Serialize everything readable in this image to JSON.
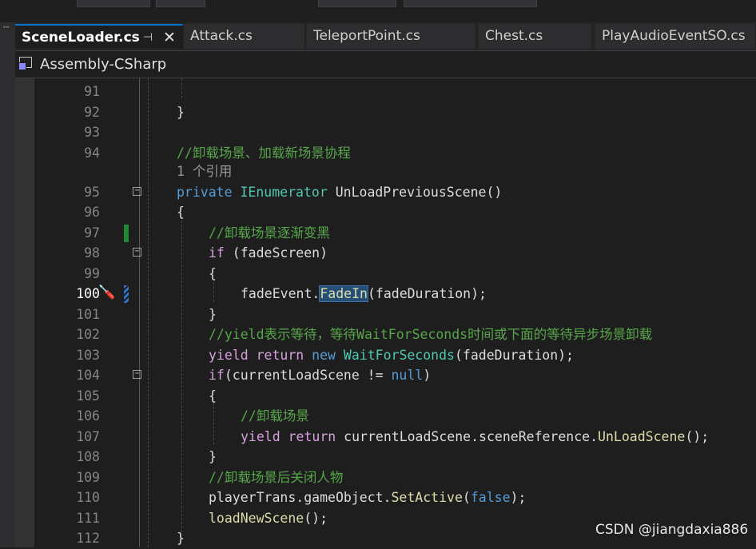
{
  "tabs": [
    {
      "label": "SceneLoader.cs",
      "active": true,
      "pin_icon": "pin-icon",
      "close_icon": "close-icon"
    },
    {
      "label": "Attack.cs"
    },
    {
      "label": "TeleportPoint.cs"
    },
    {
      "label": "Chest.cs"
    },
    {
      "label": "PlayAudioEventSO.cs"
    }
  ],
  "navbar": {
    "project": "Assembly-CSharp",
    "icon": "csharp-project-icon"
  },
  "code": {
    "lines": [
      {
        "n": "91"
      },
      {
        "n": "92",
        "text": "}"
      },
      {
        "n": "93"
      },
      {
        "n": "94",
        "comment": "//卸载场景、加载新场景协程"
      },
      {
        "hint": "1 个引用"
      },
      {
        "n": "95",
        "kw": "private",
        "type": "IEnumerator",
        "rest": "UnLoadPreviousScene()"
      },
      {
        "n": "96",
        "text": "{"
      },
      {
        "n": "97",
        "comment": "//卸载场景逐渐变黑"
      },
      {
        "n": "98",
        "kw": "if",
        "rest": " (fadeScreen)"
      },
      {
        "n": "99",
        "text": "{"
      },
      {
        "n": "100",
        "obj": "fadeEvent.",
        "method": "FadeIn",
        "args": "(fadeDuration)",
        "end": ";"
      },
      {
        "n": "101",
        "text": "}"
      },
      {
        "n": "102",
        "comment": "//yield表示等待，等待WaitForSeconds时间或下面的等待异步场景卸载"
      },
      {
        "n": "103",
        "kw1": "yield",
        "kw2": "return",
        "kw3": "new",
        "type": "WaitForSeconds",
        "rest": "(fadeDuration);"
      },
      {
        "n": "104",
        "kw": "if",
        "rest": "(currentLoadScene != ",
        "lit": "null",
        "end": ")"
      },
      {
        "n": "105",
        "text": "{"
      },
      {
        "n": "106",
        "comment": "//卸载场景"
      },
      {
        "n": "107",
        "kw1": "yield",
        "kw2": "return",
        "obj": "currentLoadScene.sceneReference.",
        "method": "UnLoadScene",
        "end": "();"
      },
      {
        "n": "108",
        "text": "}"
      },
      {
        "n": "109",
        "comment": "//卸载场景后关闭人物"
      },
      {
        "n": "110",
        "obj": "playerTrans.gameObject.",
        "method": "SetActive",
        "args_open": "(",
        "lit": "false",
        "end": ");"
      },
      {
        "n": "111",
        "method": "loadNewScene",
        "end": "();"
      },
      {
        "n": "112",
        "text": "}"
      }
    ]
  },
  "watermark": "CSDN @jiangdaxia886",
  "colors": {
    "keyword": "#569cd6",
    "control": "#d8a0df",
    "type": "#4ec9b0",
    "comment": "#57a64a",
    "method": "#dcdcaa",
    "accent": "#0078d4"
  }
}
